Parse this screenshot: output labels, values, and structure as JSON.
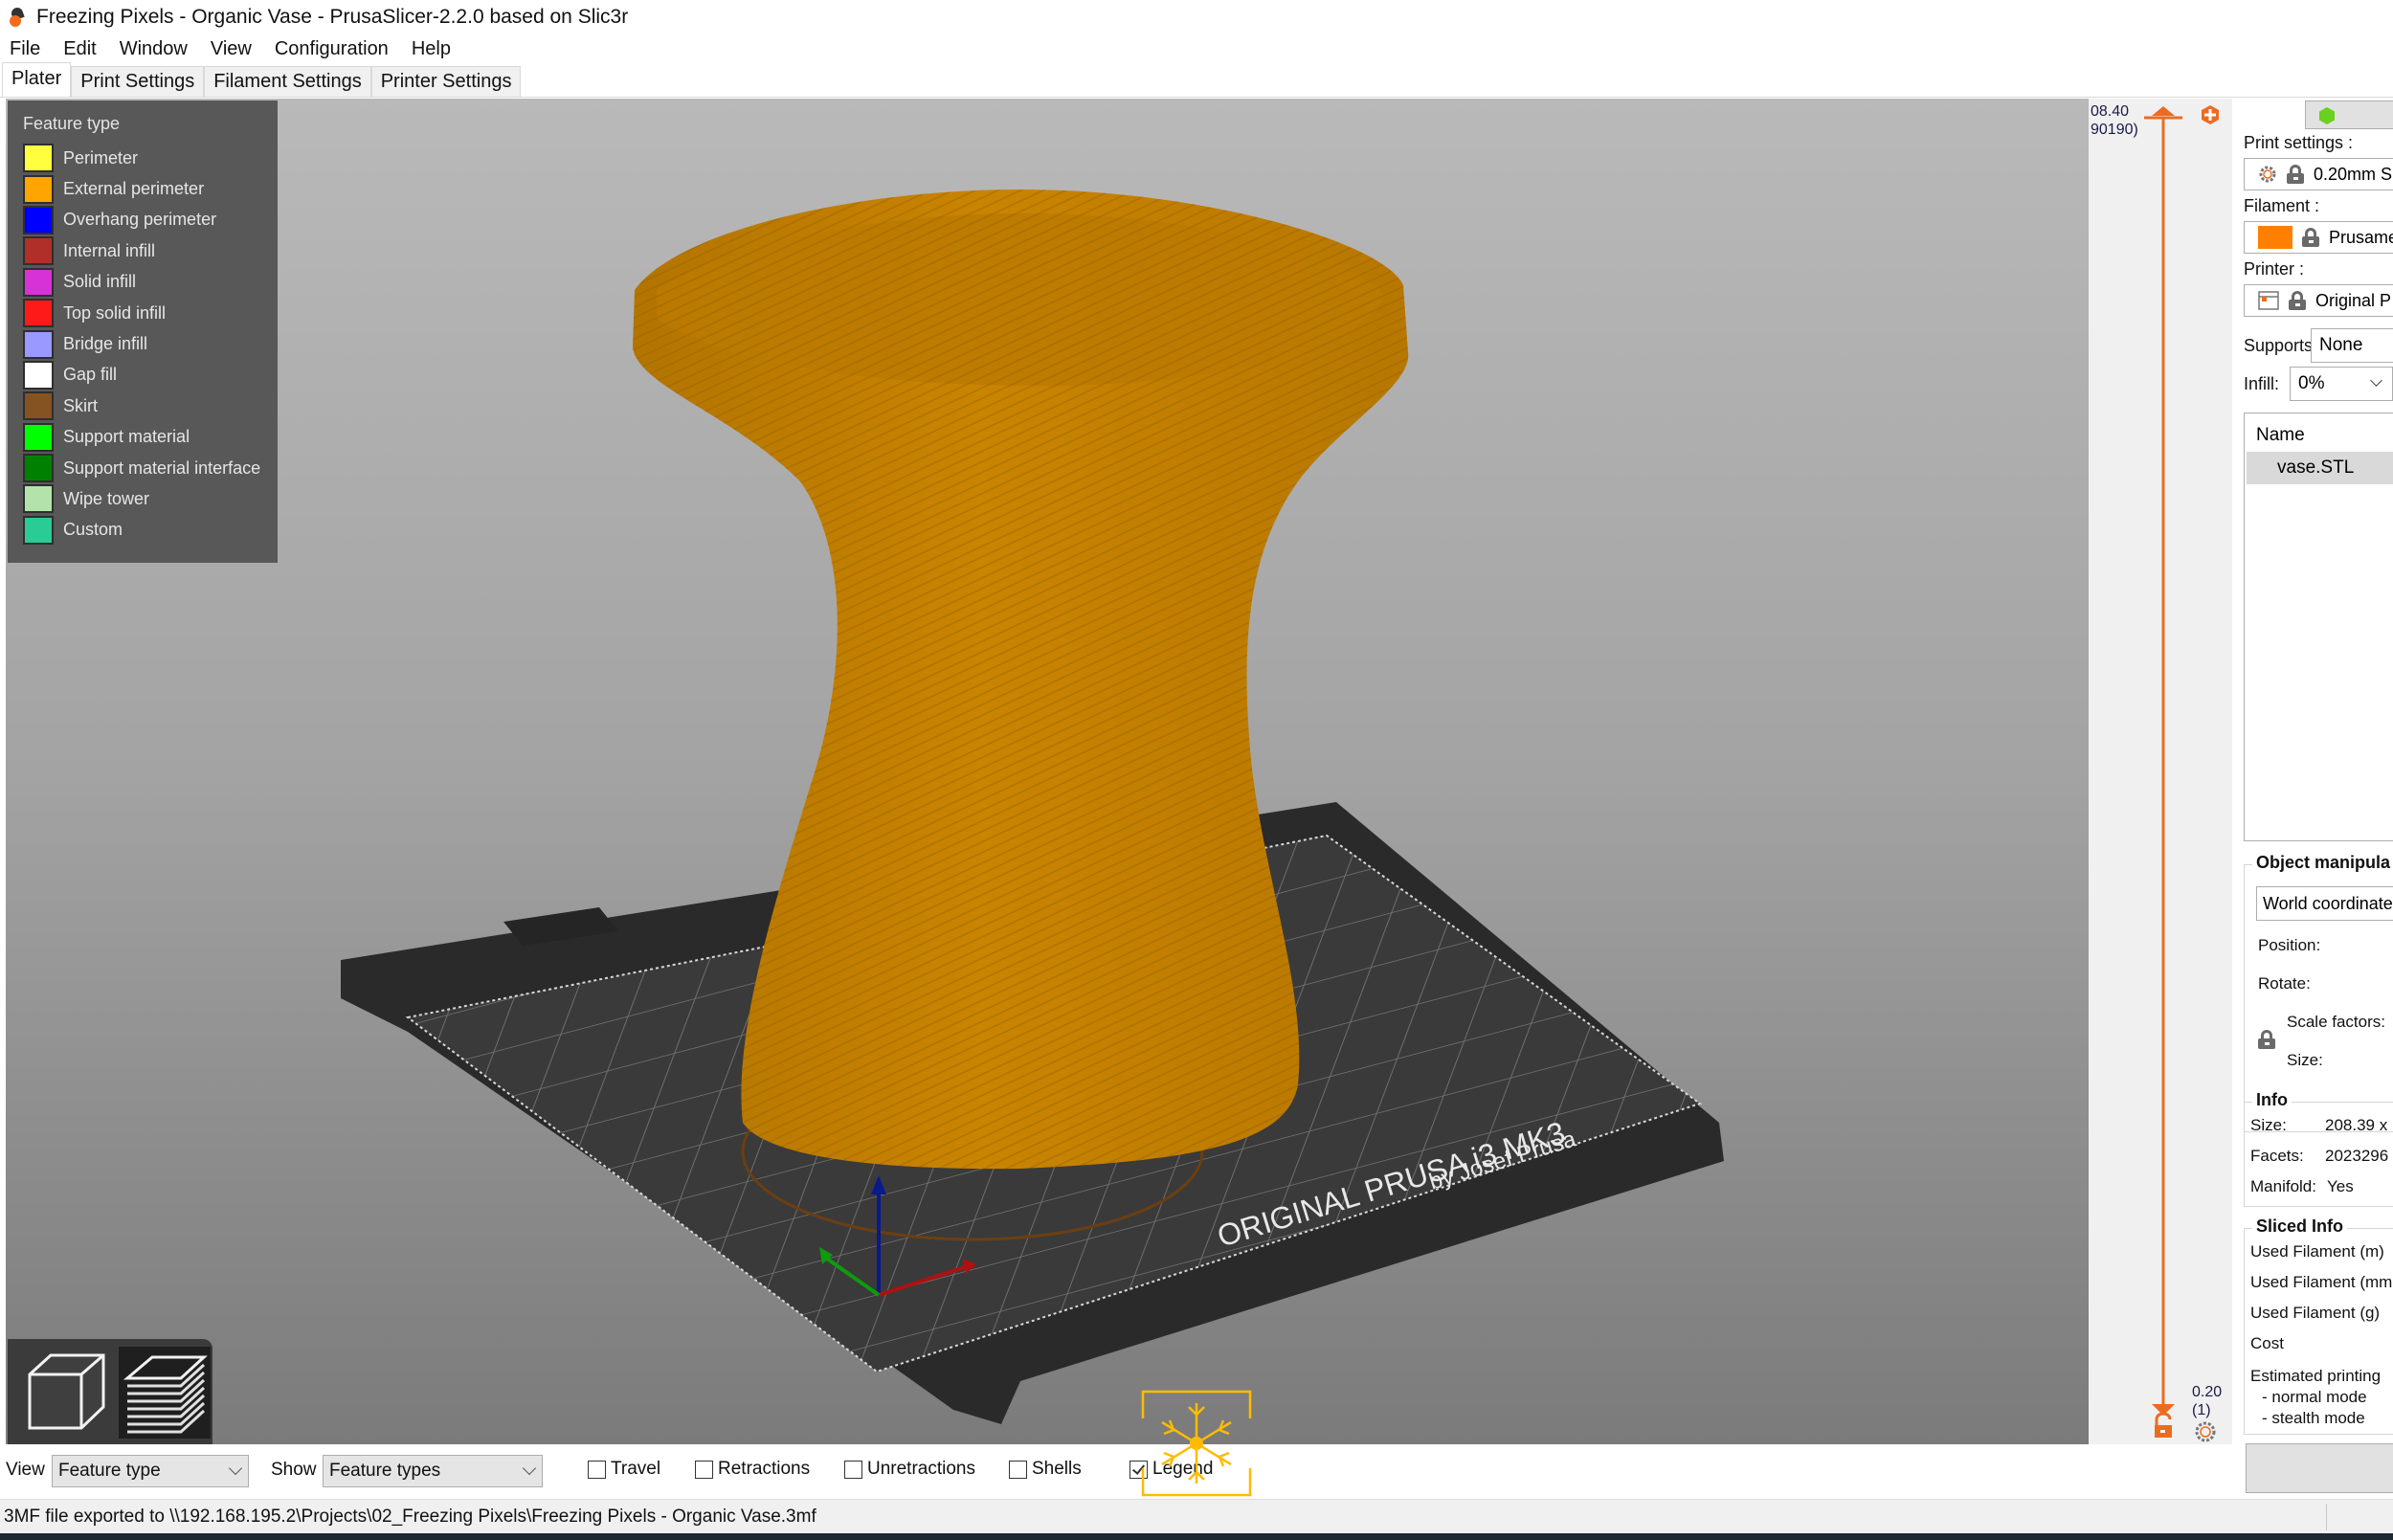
{
  "window": {
    "title": "Freezing Pixels - Organic Vase - PrusaSlicer-2.2.0 based on Slic3r",
    "app_icon": "prusaslicer-logo-icon"
  },
  "menu": [
    "File",
    "Edit",
    "Window",
    "View",
    "Configuration",
    "Help"
  ],
  "tabs": [
    {
      "label": "Plater",
      "active": true
    },
    {
      "label": "Print Settings",
      "active": false
    },
    {
      "label": "Filament Settings",
      "active": false
    },
    {
      "label": "Printer Settings",
      "active": false
    }
  ],
  "legend": {
    "title": "Feature type",
    "items": [
      {
        "label": "Perimeter",
        "color": "#ffff40"
      },
      {
        "label": "External perimeter",
        "color": "#ffa500"
      },
      {
        "label": "Overhang perimeter",
        "color": "#0000ff"
      },
      {
        "label": "Internal infill",
        "color": "#b03029"
      },
      {
        "label": "Solid infill",
        "color": "#d732d7"
      },
      {
        "label": "Top solid infill",
        "color": "#ff1a1a"
      },
      {
        "label": "Bridge infill",
        "color": "#9999ff"
      },
      {
        "label": "Gap fill",
        "color": "#ffffff"
      },
      {
        "label": "Skirt",
        "color": "#845321"
      },
      {
        "label": "Support material",
        "color": "#00ff00"
      },
      {
        "label": "Support material interface",
        "color": "#008000"
      },
      {
        "label": "Wipe tower",
        "color": "#b3e3ab"
      },
      {
        "label": "Custom",
        "color": "#28cc94"
      }
    ]
  },
  "scene": {
    "model_color": "#c88200",
    "bed_text_main": "ORIGINAL PRUSA i3 MK3",
    "bed_text_sub": "by Josef Prusa",
    "axis_colors": {
      "x": "#b01010",
      "y": "#0e9b0e",
      "z": "#0a1a8c"
    }
  },
  "view_modes": [
    {
      "name": "3d-view",
      "active": false
    },
    {
      "name": "preview",
      "active": true
    }
  ],
  "layer_slider": {
    "top_value": "08.40",
    "top_layer": "90190)",
    "bottom_value": "0.20",
    "bottom_layer": "(1)",
    "accent": "#ed6b21"
  },
  "right_panel": {
    "status_indicator_color": "#6ad11f",
    "print_settings_label": "Print settings :",
    "print_settings_value": "0.20mm S",
    "filament_label": "Filament :",
    "filament_value": "Prusament",
    "filament_color": "#ff7f00",
    "printer_label": "Printer :",
    "printer_value": "Original P",
    "supports_label": "Supports:",
    "supports_value": "None",
    "infill_label": "Infill:",
    "infill_value": "0%",
    "object_list_header": "Name",
    "objects": [
      "vase.STL"
    ],
    "object_manipulation": {
      "title": "Object manipula",
      "coordinates": "World coordinate",
      "position_label": "Position:",
      "rotate_label": "Rotate:",
      "scale_label": "Scale factors:",
      "size_label": "Size:"
    },
    "info": {
      "title": "Info",
      "size_label": "Size:",
      "size_value": "208.39 x",
      "facets_label": "Facets:",
      "facets_value": "2023296",
      "manifold_label": "Manifold:",
      "manifold_value": "Yes"
    },
    "sliced_info": {
      "title": "Sliced Info",
      "rows": [
        "Used Filament (m)",
        "Used Filament (mm",
        "Used Filament (g)",
        "Cost",
        "Estimated printing",
        "- normal mode",
        "- stealth mode"
      ]
    }
  },
  "bottom_toolbar": {
    "view_label": "View",
    "view_value": "Feature type",
    "show_label": "Show",
    "show_value": "Feature types",
    "checkboxes": [
      {
        "label": "Travel",
        "checked": false
      },
      {
        "label": "Retractions",
        "checked": false
      },
      {
        "label": "Unretractions",
        "checked": false
      },
      {
        "label": "Shells",
        "checked": false
      },
      {
        "label": "Legend",
        "checked": true
      }
    ],
    "watermark_color": "#ffbb00"
  },
  "status_bar": {
    "text": "3MF file exported to \\\\192.168.195.2\\Projects\\02_Freezing Pixels\\Freezing Pixels - Organic Vase.3mf"
  }
}
